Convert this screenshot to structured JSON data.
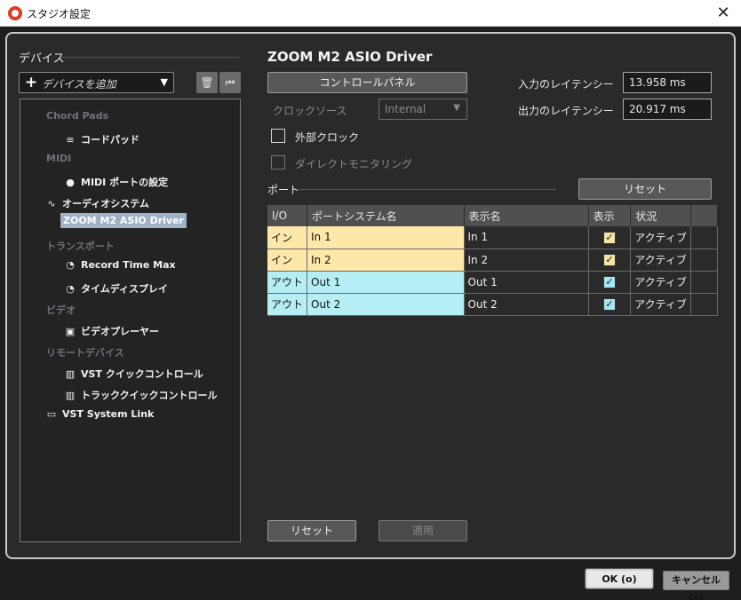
{
  "window": {
    "title": "スタジオ設定",
    "close_symbol": "✕"
  },
  "devices": {
    "heading": "デバイス",
    "add_label": "デバイスを追加",
    "add_symbol": "+",
    "dropdown_arrow": "▼",
    "delete_symbol": "🗑",
    "reset_symbol": "⏮",
    "tree": {
      "chord_pads": "Chord Pads",
      "chord_pad": "コードパッド",
      "midi": "MIDI",
      "midi_port_setup": "MIDI ポートの設定",
      "audio_system": "オーディオシステム",
      "zoom_driver": "ZOOM M2 ASIO Driver",
      "transport": "トランスポート",
      "record_time_max": "Record Time Max",
      "time_display": "タイムディスプレイ",
      "video": "ビデオ",
      "video_player": "ビデオプレーヤー",
      "remote_devices": "リモートデバイス",
      "vst_quick_controls": "VST クイックコントロール",
      "track_quick_controls": "トラッククイックコントロール",
      "vst_system_link": "VST System Link"
    },
    "icons": {
      "chord_pad": "≡",
      "midi_port": "●",
      "audio_wave": "∿",
      "clock1": "◔",
      "clock2": "◔",
      "video_player": "▣",
      "vst_quick": "▥",
      "track_quick": "▥",
      "system_link": "▭"
    }
  },
  "driver": {
    "name": "ZOOM M2 ASIO Driver",
    "control_panel": "コントロールパネル",
    "clock_source_label": "クロックソース",
    "clock_source_value": "Internal",
    "external_clock": "外部クロック",
    "direct_monitoring": "ダイレクトモニタリング",
    "input_latency_label": "入力のレイテンシー",
    "input_latency_value": "13.958 ms",
    "output_latency_label": "出力のレイテンシー",
    "output_latency_value": "20.917 ms"
  },
  "ports": {
    "heading": "ポート",
    "reset_label": "リセット",
    "columns": [
      "I/O",
      "ポートシステム名",
      "表示名",
      "表示",
      "状況"
    ],
    "rows": [
      {
        "io": "イン",
        "system_name": "In 1",
        "display_name": "In 1",
        "show": "✓",
        "status": "アクティブ"
      },
      {
        "io": "イン",
        "system_name": "In 2",
        "display_name": "In 2",
        "show": "✓",
        "status": "アクティブ"
      },
      {
        "io": "アウト",
        "system_name": "Out 1",
        "display_name": "Out 1",
        "show": "✓",
        "status": "アクティブ"
      },
      {
        "io": "アウト",
        "system_name": "Out 2",
        "display_name": "Out 2",
        "show": "✓",
        "status": "アクティブ"
      }
    ]
  },
  "footer": {
    "reset": "リセット",
    "apply": "適用",
    "ok": "OK (o)",
    "cancel": "キャンセル (c)"
  },
  "colors": {
    "accent": "#e03b1f",
    "in_row": "#fde8aa",
    "out_row": "#b6eef6",
    "selected": "#9fb1c6"
  }
}
